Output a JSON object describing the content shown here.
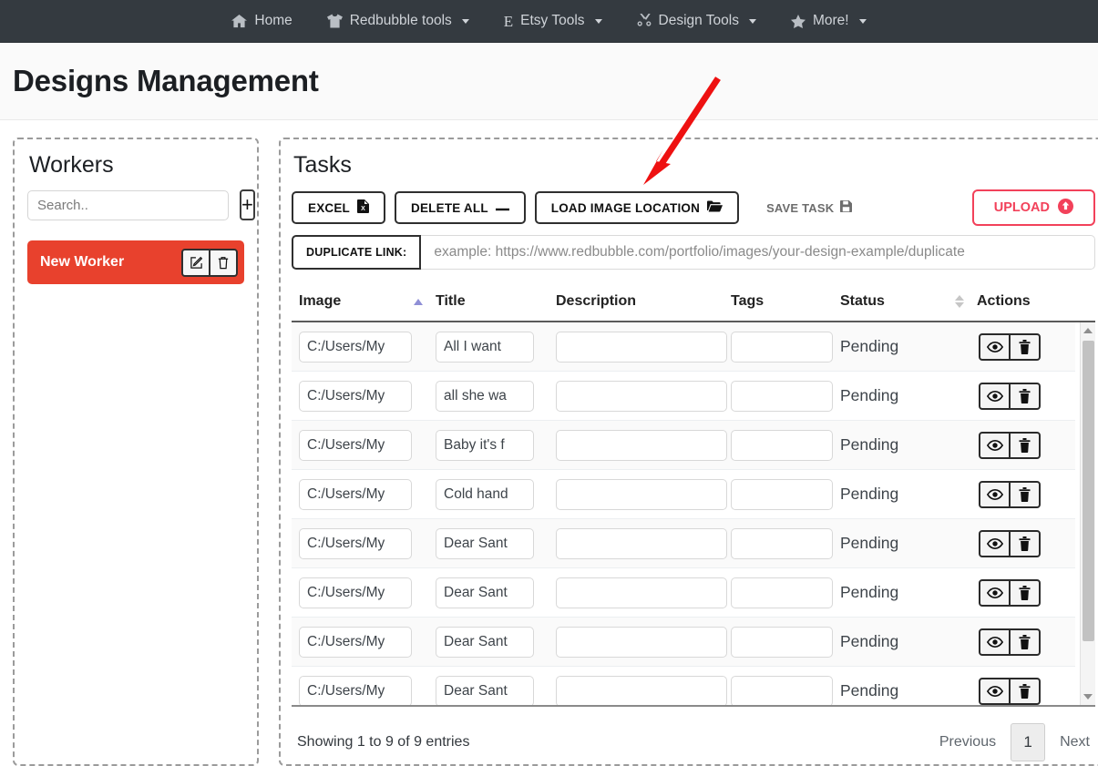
{
  "navbar": {
    "items": [
      {
        "label": "Home",
        "icon": "home-icon",
        "caret": false
      },
      {
        "label": "Redbubble tools",
        "icon": "tshirt-icon",
        "caret": true
      },
      {
        "label": "Etsy Tools",
        "icon": "etsy-e-icon",
        "caret": true
      },
      {
        "label": "Design Tools",
        "icon": "scissors-icon",
        "caret": true
      },
      {
        "label": "More!",
        "icon": "star-icon",
        "caret": true
      }
    ]
  },
  "page": {
    "title": "Designs Management"
  },
  "workers": {
    "title": "Workers",
    "search_placeholder": "Search..",
    "search_value": "",
    "add_label": "+",
    "items": [
      {
        "name": "New Worker",
        "selected": true,
        "color": "#e8412d"
      }
    ]
  },
  "tasks": {
    "title": "Tasks",
    "toolbar": {
      "excel_label": "EXCEL",
      "delete_all_label": "DELETE ALL",
      "load_image_location_label": "LOAD IMAGE LOCATION",
      "save_task_label": "SAVE TASK",
      "upload_label": "UPLOAD"
    },
    "duplicate": {
      "label": "DUPLICATE LINK:",
      "value": "",
      "placeholder": "example: https://www.redbubble.com/portfolio/images/your-design-example/duplicate"
    },
    "table": {
      "columns": [
        "Image",
        "Title",
        "Description",
        "Tags",
        "Status",
        "Actions"
      ],
      "sort": {
        "image": "asc",
        "status": "none"
      },
      "rows": [
        {
          "image": "C:/Users/My",
          "title": "All I want ",
          "description": "",
          "tags": "",
          "status": "Pending"
        },
        {
          "image": "C:/Users/My",
          "title": "all she wa",
          "description": "",
          "tags": "",
          "status": "Pending"
        },
        {
          "image": "C:/Users/My",
          "title": "Baby it's f",
          "description": "",
          "tags": "",
          "status": "Pending"
        },
        {
          "image": "C:/Users/My",
          "title": "Cold hand",
          "description": "",
          "tags": "",
          "status": "Pending"
        },
        {
          "image": "C:/Users/My",
          "title": "Dear Sant",
          "description": "",
          "tags": "",
          "status": "Pending"
        },
        {
          "image": "C:/Users/My",
          "title": "Dear Sant",
          "description": "",
          "tags": "",
          "status": "Pending"
        },
        {
          "image": "C:/Users/My",
          "title": "Dear Sant",
          "description": "",
          "tags": "",
          "status": "Pending"
        },
        {
          "image": "C:/Users/My",
          "title": "Dear Sant",
          "description": "",
          "tags": "",
          "status": "Pending"
        }
      ]
    },
    "footer": {
      "entries_info": "Showing 1 to 9 of 9 entries",
      "previous_label": "Previous",
      "page_number": "1",
      "next_label": "Next"
    }
  },
  "annotation": {
    "color": "#ee1111",
    "points_to": "load-image-location-button"
  }
}
